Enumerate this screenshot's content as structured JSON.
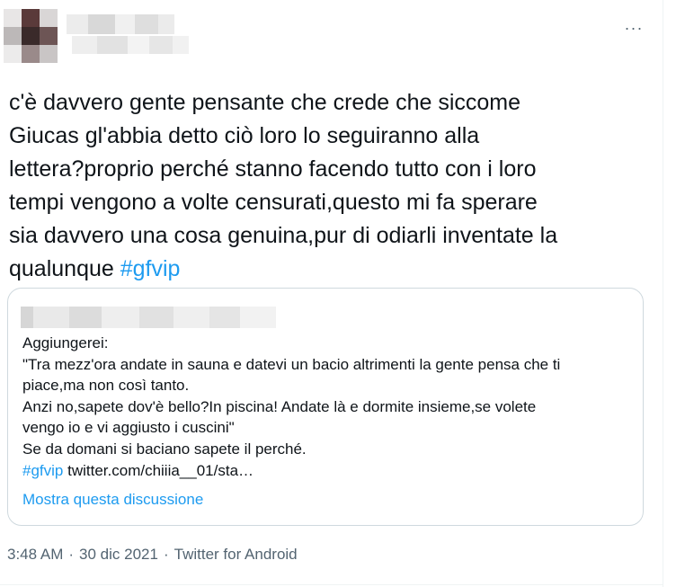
{
  "tweet": {
    "more_icon": "ellipsis-horizontal-icon",
    "more_label": "···",
    "text_main": "c'è davvero gente pensante che crede che siccome\nGiucas gl'abbia detto ciò loro lo seguiranno alla\nlettera?proprio perché stanno facendo tutto con i loro\ntempi vengono a volte censurati,questo mi fa sperare\nsia davvero una cosa genuina,pur di odiarli inventate la\nqualunque ",
    "hashtag": "#gfvip"
  },
  "quoted_tweet": {
    "text": "Aggiungerei:\n\"Tra mezz'ora andate in sauna e datevi un bacio altrimenti la gente pensa che ti\npiace,ma non così tanto.\nAnzi no,sapete dov'è bello?In piscina! Andate là e dormite insieme,se volete\nvengo io e vi aggiusto i cuscini\"\nSe da domani si baciano sapete il perché.\n",
    "hashtag": "#gfvip",
    "link": "twitter.com/chiiia__01/sta…",
    "show_thread": "Mostra questa discussione"
  },
  "meta": {
    "time": "3:48 AM",
    "separator": "·",
    "date": "30 dic 2021",
    "source": "Twitter for Android"
  },
  "colors": {
    "accent": "#1d9bf0",
    "text": "#0f1419",
    "muted": "#536471",
    "border": "#cfd9de"
  }
}
